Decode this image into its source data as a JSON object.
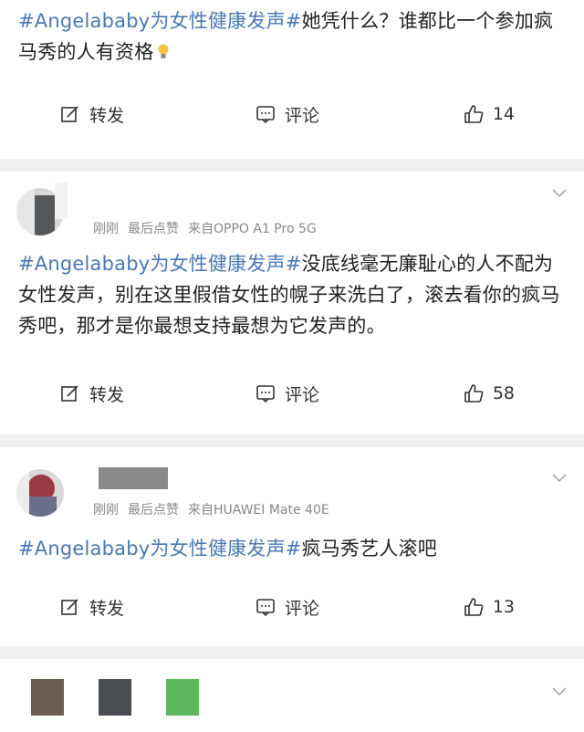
{
  "posts": [
    {
      "topic": "#Angelababy为女性健康发声#",
      "text": "她凭什么？谁都比一个参加疯马秀的人有资格",
      "repost_label": "转发",
      "comment_label": "评论",
      "like_count": "14"
    },
    {
      "time": "刚刚",
      "liked_label": "最后点赞",
      "source": "来自OPPO A1 Pro 5G",
      "topic": "#Angelababy为女性健康发声#",
      "text": "没底线毫无廉耻心的人不配为女性发声，别在这里假借女性的幌子来洗白了，滚去看你的疯马秀吧，那才是你最想支持最想为它发声的。",
      "repost_label": "转发",
      "comment_label": "评论",
      "like_count": "58"
    },
    {
      "time": "刚刚",
      "liked_label": "最后点赞",
      "source": "来自HUAWEI Mate 40E",
      "topic": "#Angelababy为女性健康发声#",
      "text": "疯马秀艺人滚吧",
      "repost_label": "转发",
      "comment_label": "评论",
      "like_count": "13"
    }
  ],
  "colors": {
    "topic": "#4a78b0",
    "separator": "#f0f0f0"
  }
}
